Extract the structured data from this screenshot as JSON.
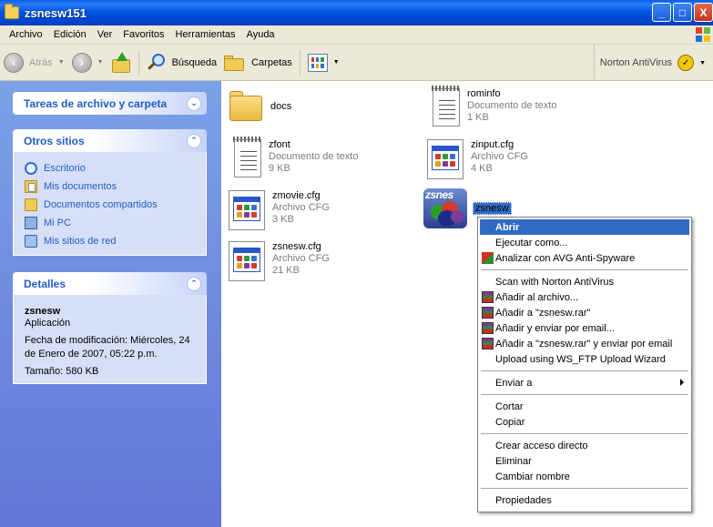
{
  "window": {
    "title": "zsnesw151"
  },
  "title_buttons": {
    "minimize": "_",
    "maximize": "□",
    "close": "X"
  },
  "menubar": [
    "Archivo",
    "Edición",
    "Ver",
    "Favoritos",
    "Herramientas",
    "Ayuda"
  ],
  "toolbar": {
    "back": "Atrás",
    "search": "Búsqueda",
    "folders": "Carpetas",
    "norton": "Norton AntiVirus"
  },
  "left": {
    "tasks_title": "Tareas de archivo y carpeta",
    "places_title": "Otros sitios",
    "places": [
      "Escritorio",
      "Mis documentos",
      "Documentos compartidos",
      "Mi PC",
      "Mis sitios de red"
    ],
    "details_title": "Detalles",
    "details_name": "zsnesw",
    "details_type": "Aplicación",
    "details_modified": "Fecha de modificación: Miércoles, 24 de Enero de 2007, 05:22 p.m.",
    "details_size": "Tamaño: 580 KB"
  },
  "files": [
    {
      "name": "docs",
      "type": "",
      "size": ""
    },
    {
      "name": "rominfo",
      "type": "Documento de texto",
      "size": "1 KB"
    },
    {
      "name": "zfont",
      "type": "Documento de texto",
      "size": "9 KB"
    },
    {
      "name": "zinput.cfg",
      "type": "Archivo CFG",
      "size": "4 KB"
    },
    {
      "name": "zmovie.cfg",
      "type": "Archivo CFG",
      "size": "3 KB"
    },
    {
      "name": "zsnesw",
      "type": "",
      "size": ""
    },
    {
      "name": "zsnesw.cfg",
      "type": "Archivo CFG",
      "size": "21 KB"
    }
  ],
  "zsnes_icon_text": "zsnes",
  "context_menu": [
    "Abrir",
    "Ejecutar como...",
    "Analizar con AVG Anti-Spyware",
    "Scan with Norton AntiVirus",
    "Añadir al archivo...",
    "Añadir a \"zsnesw.rar\"",
    "Añadir y enviar por email...",
    "Añadir a \"zsnesw.rar\" y enviar por email",
    "Upload using WS_FTP Upload Wizard",
    "Enviar a",
    "Cortar",
    "Copiar",
    "Crear acceso directo",
    "Eliminar",
    "Cambiar nombre",
    "Propiedades"
  ],
  "colors": {
    "selection": "#316ac5",
    "link": "#215dc6",
    "titlebar": "#0054e3"
  }
}
